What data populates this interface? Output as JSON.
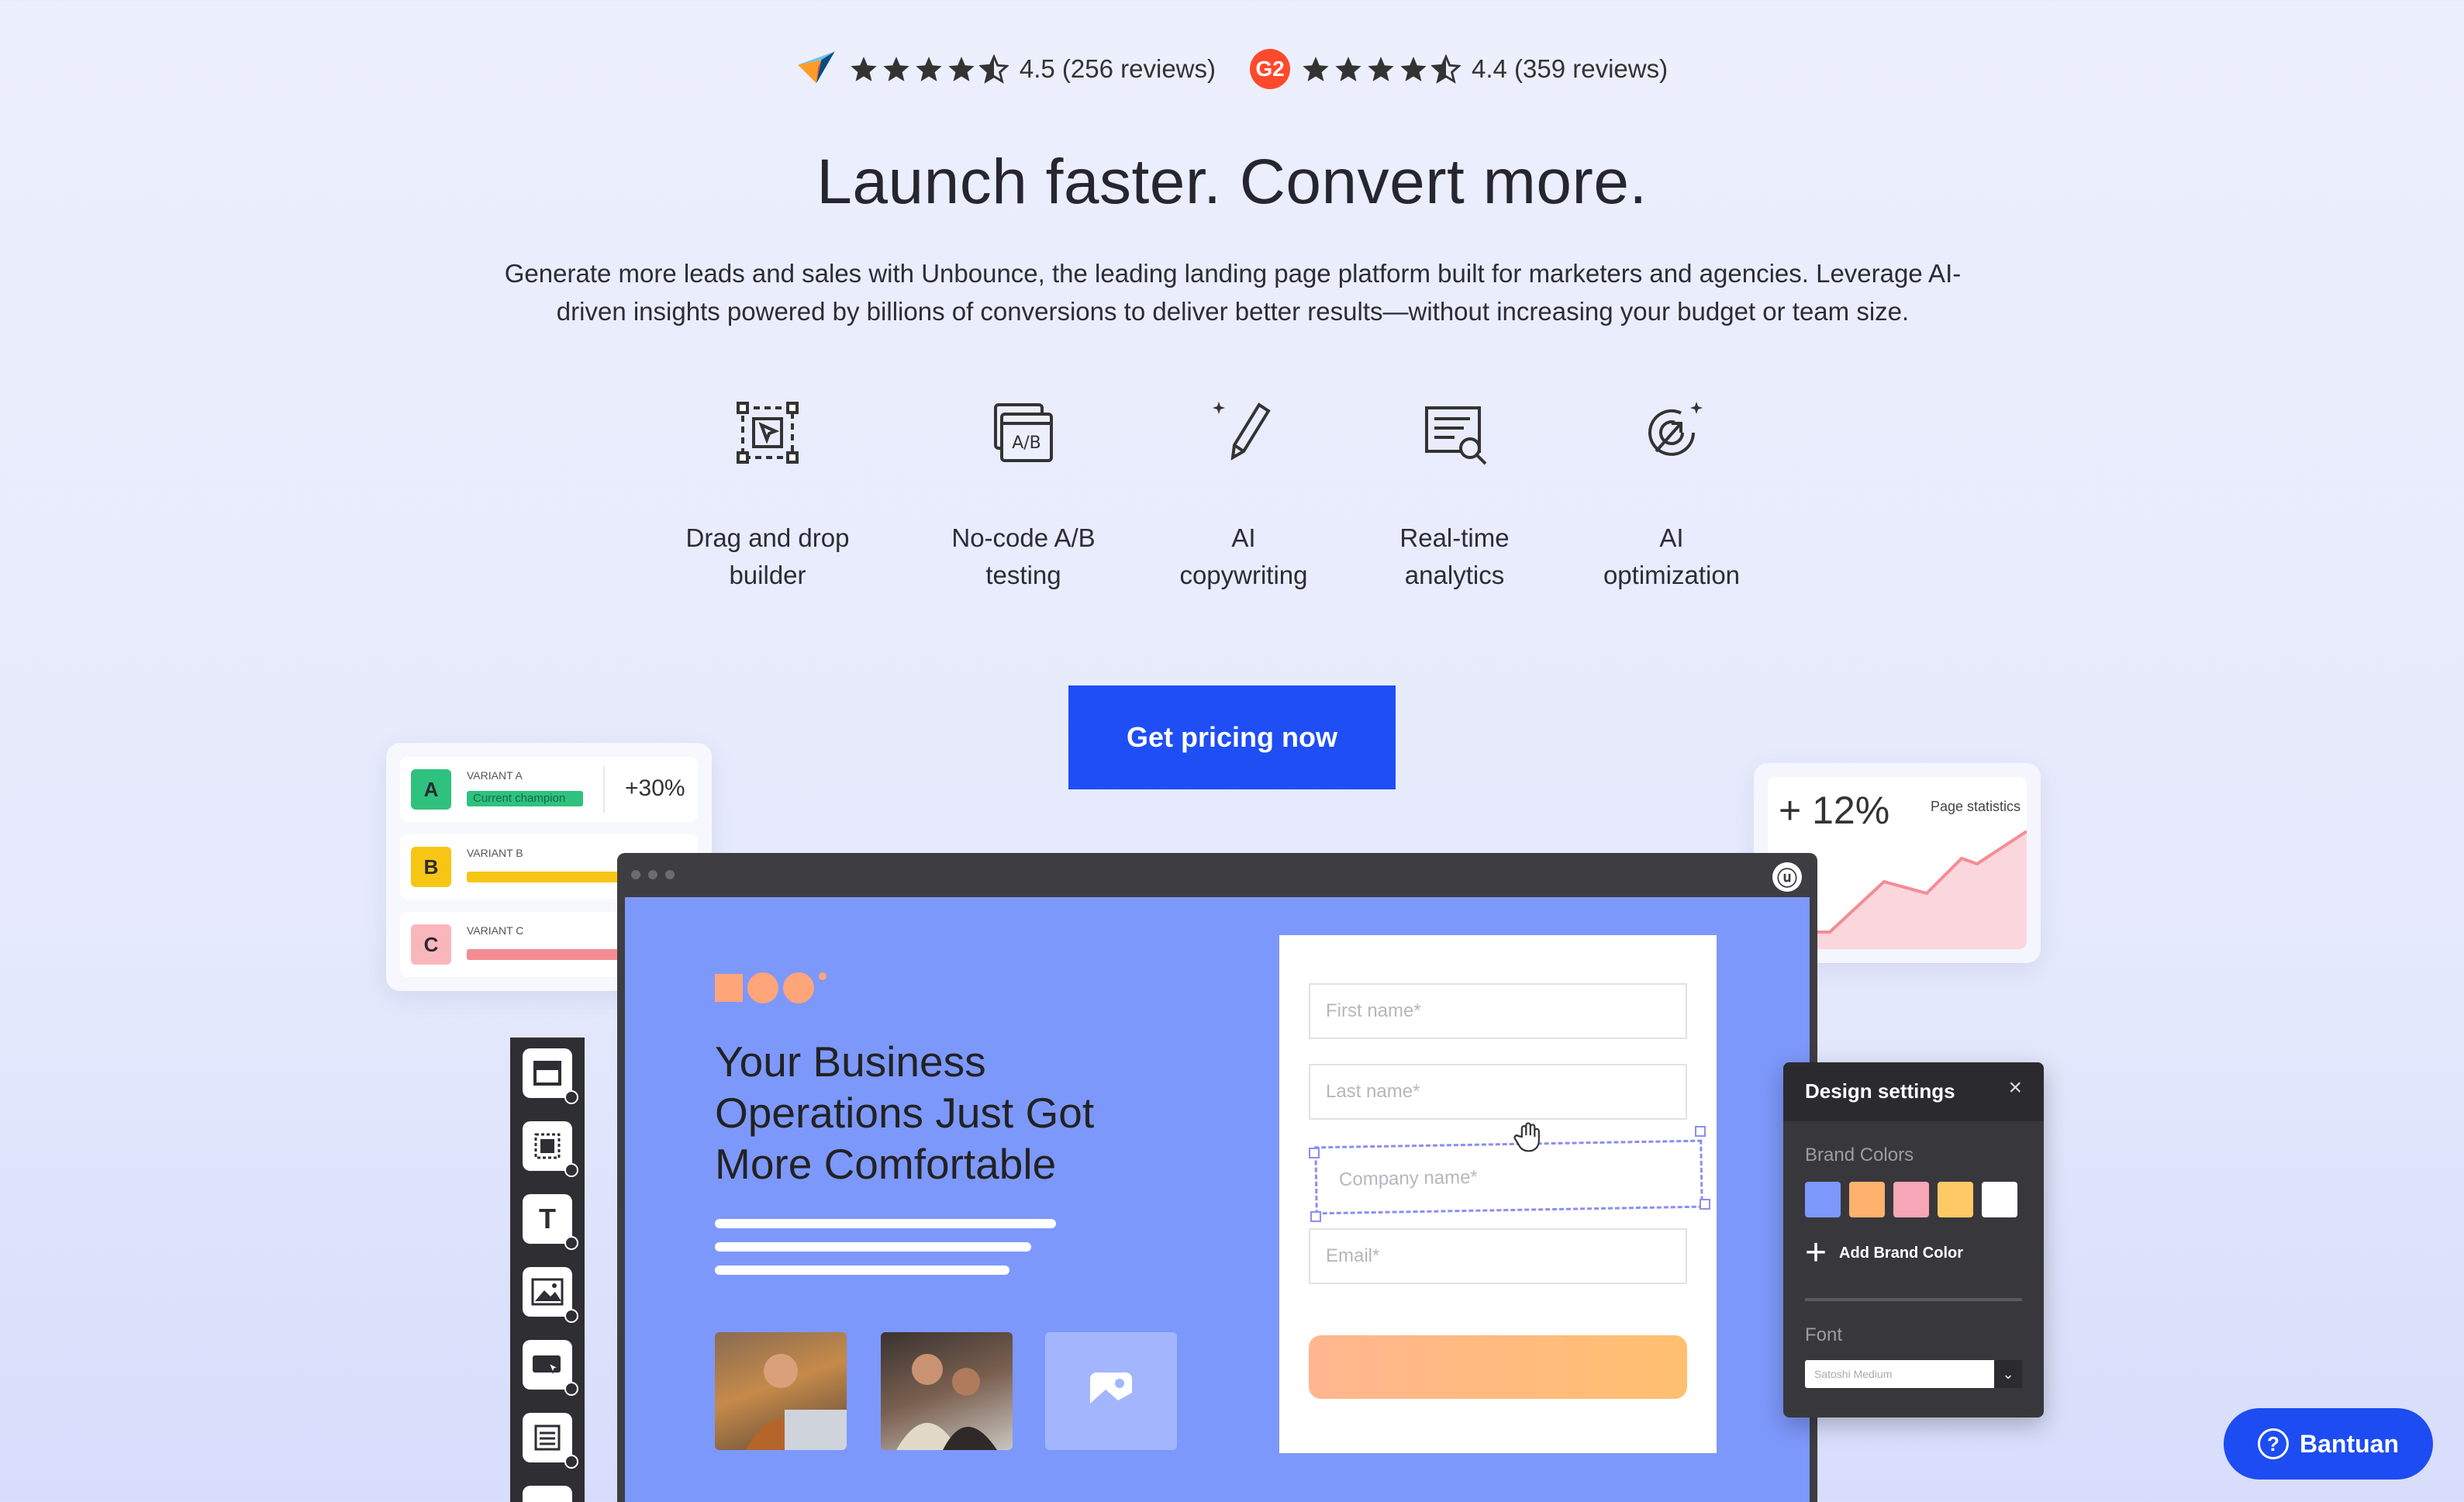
{
  "ratings": [
    {
      "source_icon": "capterra-logo-icon",
      "stars": 4.5,
      "text": "4.5 (256 reviews)"
    },
    {
      "source_icon": "g2-logo-icon",
      "logo_text": "G2",
      "stars": 4.5,
      "text": "4.4 (359 reviews)"
    }
  ],
  "hero": {
    "title": "Launch faster. Convert more.",
    "lead": "Generate more leads and sales with Unbounce, the leading landing page platform built for marketers and agencies. Leverage AI-driven insights powered by billions of conversions to deliver better results—without increasing your budget or team size."
  },
  "features": [
    {
      "icon": "drag-drop-icon",
      "line1": "Drag and drop",
      "line2": "builder"
    },
    {
      "icon": "ab-testing-icon",
      "line1": "No-code A/B",
      "line2": "testing",
      "icon_text": "A/B"
    },
    {
      "icon": "ai-pen-icon",
      "line1": "AI",
      "line2": "copywriting"
    },
    {
      "icon": "analytics-icon",
      "line1": "Real-time",
      "line2": "analytics"
    },
    {
      "icon": "ai-target-icon",
      "line1": "AI",
      "line2": "optimization"
    }
  ],
  "cta": {
    "label": "Get pricing now"
  },
  "variants": {
    "rows": [
      {
        "badge": "A",
        "name": "VARIANT A",
        "bar_label": "Current champion",
        "color": "#2ec27e"
      },
      {
        "badge": "B",
        "name": "VARIANT B",
        "color": "#f7c614"
      },
      {
        "badge": "C",
        "name": "VARIANT C",
        "color": "#f48c94"
      }
    ],
    "uplift": "+30%"
  },
  "stats": {
    "value": "+ 12%",
    "caption": "Page statistics"
  },
  "mock": {
    "headline": "Your Business Operations Just Got More Comfortable",
    "form": {
      "first_name": "First name*",
      "last_name": "Last name*",
      "company": "Company name*",
      "email": "Email*"
    },
    "toolbar": [
      {
        "icon": "section-icon"
      },
      {
        "icon": "box-icon"
      },
      {
        "icon": "text-icon",
        "glyph": "T"
      },
      {
        "icon": "image-icon"
      },
      {
        "icon": "button-icon"
      },
      {
        "icon": "form-icon"
      }
    ]
  },
  "design_settings": {
    "title": "Design settings",
    "close": "×",
    "brand_colors_label": "Brand Colors",
    "swatches": [
      "#7d98fb",
      "#ffb26e",
      "#f6a6b6",
      "#ffc966",
      "#ffffff"
    ],
    "add_label": "Add Brand Color",
    "add_glyph": "+",
    "font_label": "Font",
    "font_value": "Satoshi Medium"
  },
  "help": {
    "label": "Bantuan",
    "glyph": "?"
  },
  "colors": {
    "primary": "#1f4ef5",
    "canvas": "#7d98fb"
  }
}
